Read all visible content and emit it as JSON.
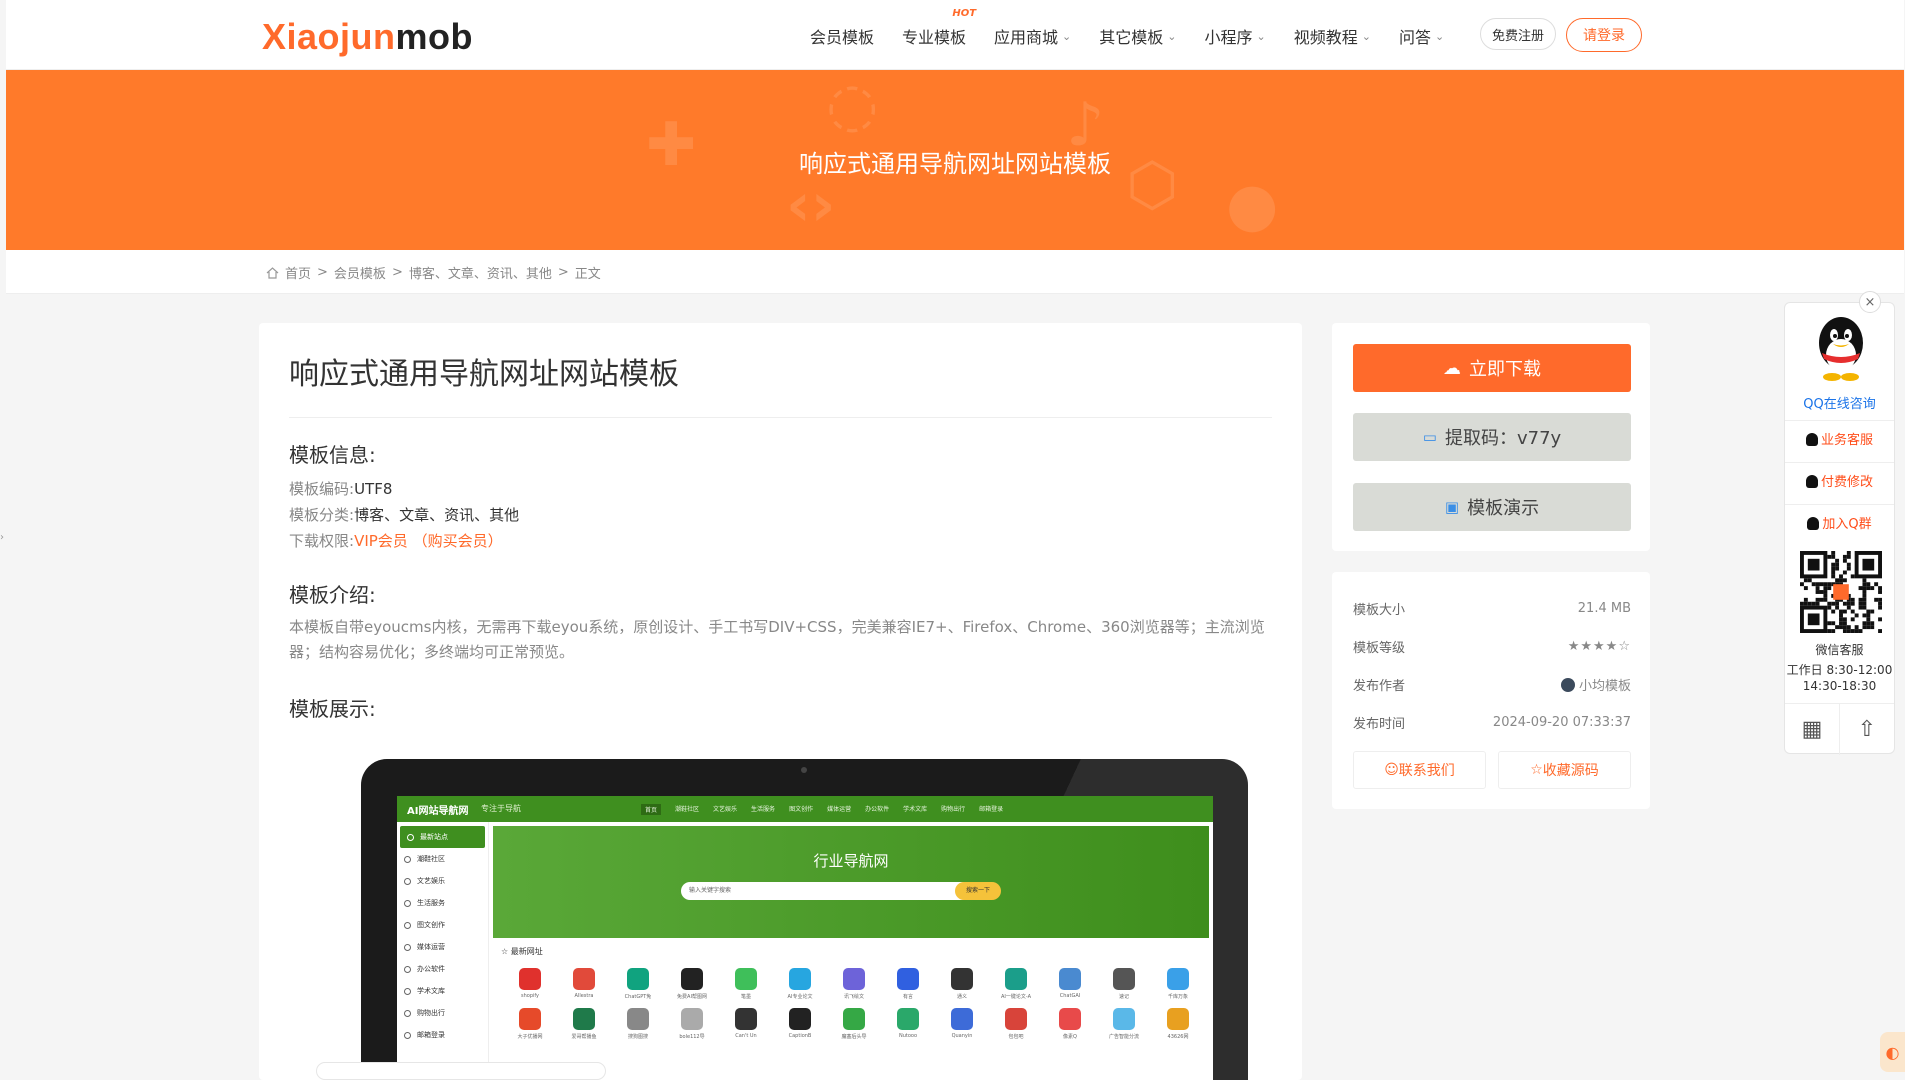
{
  "header": {
    "logo_part1": "Xiaojun",
    "logo_part2": "mob",
    "nav": [
      {
        "label": "会员模板",
        "chevron": false,
        "hot": ""
      },
      {
        "label": "专业模板",
        "chevron": false,
        "hot": "HOT"
      },
      {
        "label": "应用商城",
        "chevron": true,
        "hot": ""
      },
      {
        "label": "其它模板",
        "chevron": true,
        "hot": ""
      },
      {
        "label": "小程序",
        "chevron": true,
        "hot": ""
      },
      {
        "label": "视频教程",
        "chevron": true,
        "hot": ""
      },
      {
        "label": "问答",
        "chevron": true,
        "hot": ""
      }
    ],
    "register_label": "免费注册",
    "login_label": "请登录"
  },
  "banner": {
    "title": "响应式通用导航网址网站模板"
  },
  "breadcrumb": {
    "home": "首页",
    "sep": ">",
    "level1": "会员模板",
    "level2": "博客、文章、资讯、其他",
    "current": "正文"
  },
  "article": {
    "title": "响应式通用导航网址网站模板",
    "info_heading": "模板信息:",
    "encoding_label": "模板编码:",
    "encoding_value": "UTF8",
    "category_label": "模板分类:",
    "category_value": "博客、文章、资讯、其他",
    "perm_label": "下载权限:",
    "perm_value": "VIP会员",
    "perm_buy": "（购买会员）",
    "intro_heading": "模板介绍:",
    "intro_text": "本模板自带eyoucms内核，无需再下载eyou系统，原创设计、手工书写DIV+CSS，完美兼容IE7+、Firefox、Chrome、360浏览器等；主流浏览器；结构容易优化；多终端均可正常预览。",
    "demo_heading": "模板展示:"
  },
  "preview": {
    "logo": "AI网站导航网",
    "slogan": "专注于导航",
    "nav": [
      "首页",
      "潮鞋社区",
      "文艺娱乐",
      "生活服务",
      "图文创作",
      "媒体运营",
      "办公软件",
      "学术文库",
      "购物出行",
      "邮箱登录"
    ],
    "side": [
      "最新站点",
      "潮鞋社区",
      "文艺娱乐",
      "生活服务",
      "图文创作",
      "媒体运营",
      "办公软件",
      "学术文库",
      "购物出行",
      "邮箱登录"
    ],
    "hero_title": "行业导航网",
    "search_placeholder": "输入关键字搜索",
    "search_button": "搜索一下",
    "latest_label": "最新网址",
    "icons": [
      {
        "label": "shopify",
        "color": "#e0312d"
      },
      {
        "label": "Allestra",
        "color": "#e14a3a"
      },
      {
        "label": "ChatGPT免",
        "color": "#10a37f"
      },
      {
        "label": "免费AI帮图网",
        "color": "#222222"
      },
      {
        "label": "笔墨",
        "color": "#3fbf5a"
      },
      {
        "label": "AI专业论文",
        "color": "#27a6e0"
      },
      {
        "label": "讯飞绘文",
        "color": "#6d63d9"
      },
      {
        "label": "有言",
        "color": "#3060e0"
      },
      {
        "label": "通义",
        "color": "#333333"
      },
      {
        "label": "AI一键论文-A",
        "color": "#1b9e8a"
      },
      {
        "label": "ChatGAI",
        "color": "#4a8ad0"
      },
      {
        "label": "速记",
        "color": "#555555"
      },
      {
        "label": "千库万象",
        "color": "#3aa0e8"
      },
      {
        "label": "大子优播网",
        "color": "#e64a2a"
      },
      {
        "label": "爱哥帮播鱼",
        "color": "#1f7a4a"
      },
      {
        "label": "搜狗图搜",
        "color": "#888888"
      },
      {
        "label": "bole112导",
        "color": "#aaaaaa"
      },
      {
        "label": "Can't Un",
        "color": "#333333"
      },
      {
        "label": "CaptionB",
        "color": "#222222"
      },
      {
        "label": "魔塞后头导",
        "color": "#35a845"
      },
      {
        "label": "Nutooo",
        "color": "#2aa86a"
      },
      {
        "label": "Quanyin",
        "color": "#3d6bd8"
      },
      {
        "label": "包包吧",
        "color": "#d8443a"
      },
      {
        "label": "像素Q",
        "color": "#e84a4a"
      },
      {
        "label": "广告智能分流",
        "color": "#5ab8e8"
      },
      {
        "label": "43626网",
        "color": "#e8a020"
      }
    ]
  },
  "sidebar": {
    "download_label": "立即下载",
    "code_label": "提取码：v77y",
    "demo_label": "模板演示",
    "rows": [
      {
        "k": "模板大小",
        "v": "21.4 MB"
      },
      {
        "k": "模板等级",
        "v": "★★★★☆"
      },
      {
        "k": "发布作者",
        "v": "小均模板"
      },
      {
        "k": "发布时间",
        "v": "2024-09-20 07:33:37"
      }
    ],
    "contact_label": "联系我们",
    "favorite_label": "收藏源码"
  },
  "float_panel": {
    "qq_label": "QQ在线咨询",
    "links": [
      "业务客服",
      "付费修改",
      "加入Q群"
    ],
    "wechat_label": "微信客服",
    "hours1": "工作日 8:30-12:00",
    "hours2": "14:30-18:30",
    "close": "×"
  },
  "colors": {
    "accent": "#ff6a2b",
    "banner": "#ff7a2a",
    "preview_green": "#3f8f1f"
  }
}
